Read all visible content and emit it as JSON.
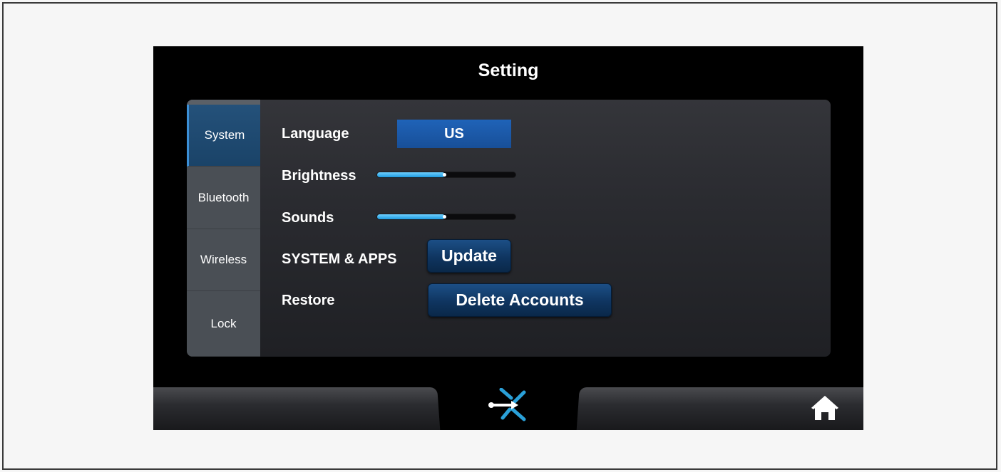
{
  "screen": {
    "title": "Setting"
  },
  "sidebar": {
    "items": [
      {
        "label": "System",
        "active": true
      },
      {
        "label": "Bluetooth",
        "active": false
      },
      {
        "label": "Wireless",
        "active": false
      },
      {
        "label": "Lock",
        "active": false
      }
    ]
  },
  "settings": {
    "language": {
      "label": "Language",
      "value": "US"
    },
    "brightness": {
      "label": "Brightness",
      "level_percent": 49
    },
    "sounds": {
      "label": "Sounds",
      "level_percent": 49
    },
    "system_apps": {
      "label": "SYSTEM & APPS",
      "button": "Update"
    },
    "restore": {
      "label": "Restore",
      "button": "Delete Accounts"
    }
  },
  "bottom_bar": {
    "logo_icon": "brand-logo-icon",
    "home_icon": "home-icon"
  },
  "colors": {
    "accent_blue": "#1f63b8",
    "slider_fill": "#1e9be0",
    "button_blue": "#0f3560"
  }
}
